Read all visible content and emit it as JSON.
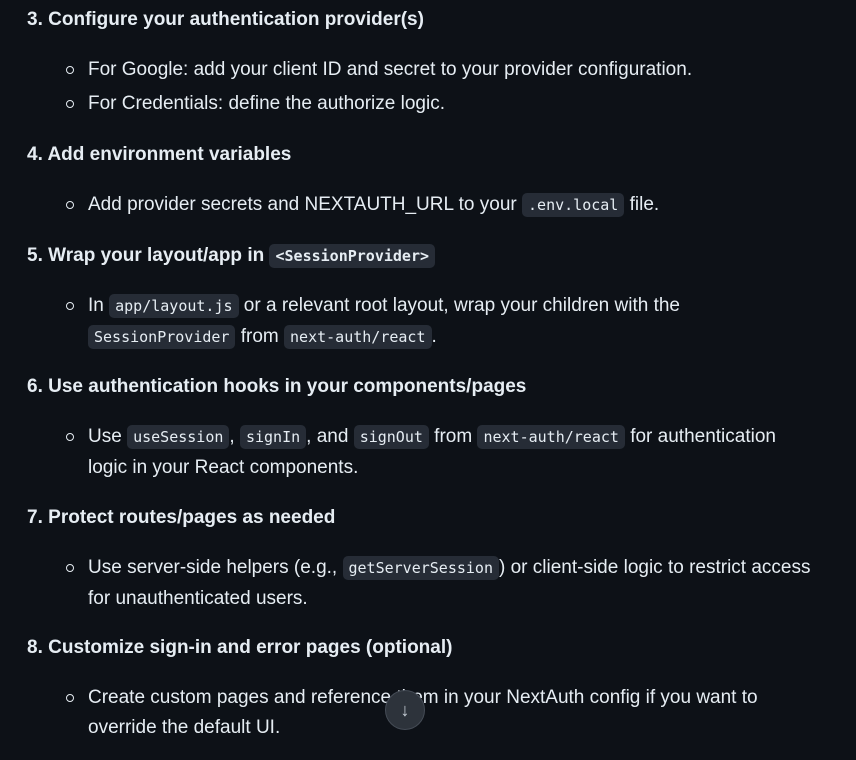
{
  "steps": [
    {
      "number": "3.",
      "title": "Configure your authentication provider(s)",
      "bullets": [
        {
          "text": "For Google: add your client ID and secret to your provider configuration."
        },
        {
          "text": "For Credentials: define the authorize logic."
        }
      ]
    },
    {
      "number": "4.",
      "title": "Add environment variables",
      "bullets": [
        {
          "pre": "Add provider secrets and NEXTAUTH_URL to your ",
          "code": ".env.local",
          "post": " file."
        }
      ]
    },
    {
      "number": "5.",
      "title_pre": "Wrap your layout/app in ",
      "title_code": "<SessionProvider>",
      "bullets": [
        {
          "line1_pre": "In ",
          "line1_code": "app/layout.js",
          "line1_post": " or a relevant root layout, wrap your children with the",
          "line2_code1": "SessionProvider",
          "line2_mid": " from ",
          "line2_code2": "next-auth/react",
          "line2_post": "."
        }
      ]
    },
    {
      "number": "6.",
      "title": "Use authentication hooks in your components/pages",
      "bullets": [
        {
          "line1_pre": "Use ",
          "code1": "useSession",
          "sep1": ", ",
          "code2": "signIn",
          "sep2": ", and ",
          "code3": "signOut",
          "mid": " from ",
          "code4": "next-auth/react",
          "line1_post": " for authentication",
          "line2": "logic in your React components."
        }
      ]
    },
    {
      "number": "7.",
      "title": "Protect routes/pages as needed",
      "bullets": [
        {
          "line1_pre": "Use server-side helpers (e.g., ",
          "code": "getServerSession",
          "line1_post": ") or client-side logic to restrict access",
          "line2": "for unauthenticated users."
        }
      ]
    },
    {
      "number": "8.",
      "title": "Customize sign-in and error pages (optional)",
      "bullets": [
        {
          "line1": "Create custom pages and reference them in your NextAuth config if you want to",
          "line2": "override the default UI."
        }
      ]
    }
  ],
  "scroll_button": {
    "icon": "arrow-down-icon",
    "glyph": "↓"
  }
}
